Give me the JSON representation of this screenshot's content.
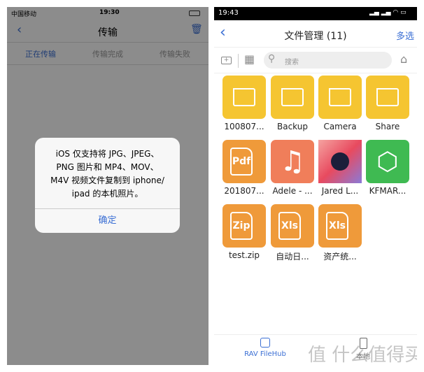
{
  "left": {
    "status": {
      "carrier": "中国移动",
      "time": "19:30"
    },
    "nav": {
      "title": "传输",
      "back_icon": "chevron-left-icon",
      "delete_icon": "trash-icon"
    },
    "tabs": [
      {
        "label": "正在传输",
        "active": true
      },
      {
        "label": "传输完成"
      },
      {
        "label": "传输失败"
      }
    ],
    "dialog": {
      "lines": [
        "iOS 仅支持将 JPG、JPEG、",
        "PNG 图片和 MP4、MOV、",
        "M4V 视频文件复制到 iphone/",
        "ipad 的本机照片。"
      ],
      "confirm": "确定"
    }
  },
  "right": {
    "status": {
      "time": "19:43"
    },
    "nav": {
      "title": "文件管理 (11)",
      "multi_select": "多选"
    },
    "search": {
      "placeholder": "搜索"
    },
    "files": [
      {
        "name": "100807...",
        "type": "folder",
        "color": "#f5c531"
      },
      {
        "name": "Backup",
        "type": "folder",
        "color": "#f5c531"
      },
      {
        "name": "Camera",
        "type": "folder",
        "color": "#f5c531"
      },
      {
        "name": "Share",
        "type": "folder",
        "color": "#f5c531"
      },
      {
        "name": "201807...",
        "type": "pdf",
        "badge": "Pdf",
        "color": "#ef9a3a"
      },
      {
        "name": "Adele - ...",
        "type": "music",
        "color": "#f07e5a"
      },
      {
        "name": "Jared L...",
        "type": "image",
        "color": "#e95c6a"
      },
      {
        "name": "KFMAR...",
        "type": "package",
        "color": "#3fba52"
      },
      {
        "name": "test.zip",
        "type": "zip",
        "badge": "Zip",
        "color": "#ef9a3a"
      },
      {
        "name": "自动日...",
        "type": "xls",
        "badge": "Xls",
        "color": "#ef9a3a"
      },
      {
        "name": "资产统...",
        "type": "xls",
        "badge": "Xls",
        "color": "#ef9a3a"
      }
    ],
    "bottom_tabs": [
      {
        "label": "RAV FileHub",
        "active": true,
        "icon": "drive-icon"
      },
      {
        "label": "本地",
        "icon": "phone-icon"
      }
    ],
    "watermark": "值 什么值得买",
    "accent": "#3b6fd4"
  }
}
